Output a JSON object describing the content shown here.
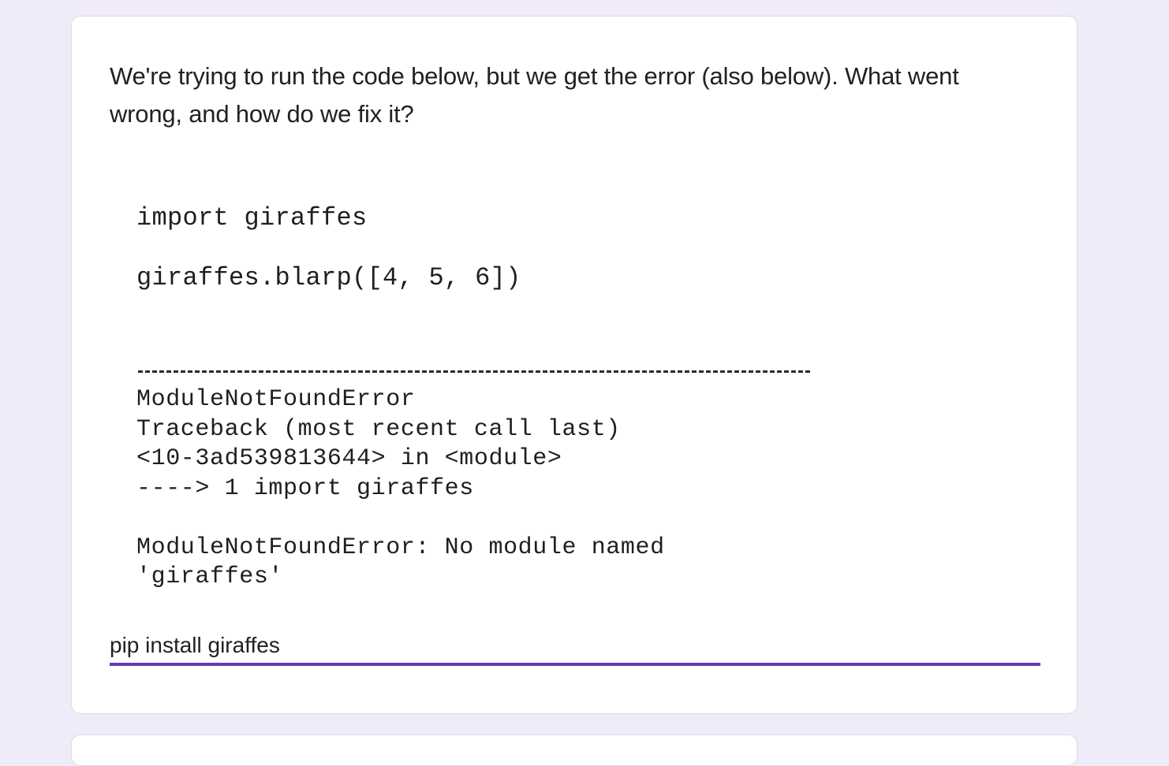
{
  "question": {
    "title": "We're trying to run the code below, but we get the error (also below). What went wrong, and how do we fix it?"
  },
  "code_image": {
    "lines": [
      "import giraffes",
      "giraffes.blarp([4, 5, 6])",
      "ModuleNotFoundError",
      "Traceback (most recent call last)",
      "<10-3ad539813644> in <module>",
      "----> 1 import giraffes",
      "ModuleNotFoundError: No module named",
      "'giraffes'"
    ]
  },
  "answer": {
    "value": "pip install giraffes"
  },
  "colors": {
    "page_background": "#f0ebf8",
    "accent": "#673ab7"
  }
}
